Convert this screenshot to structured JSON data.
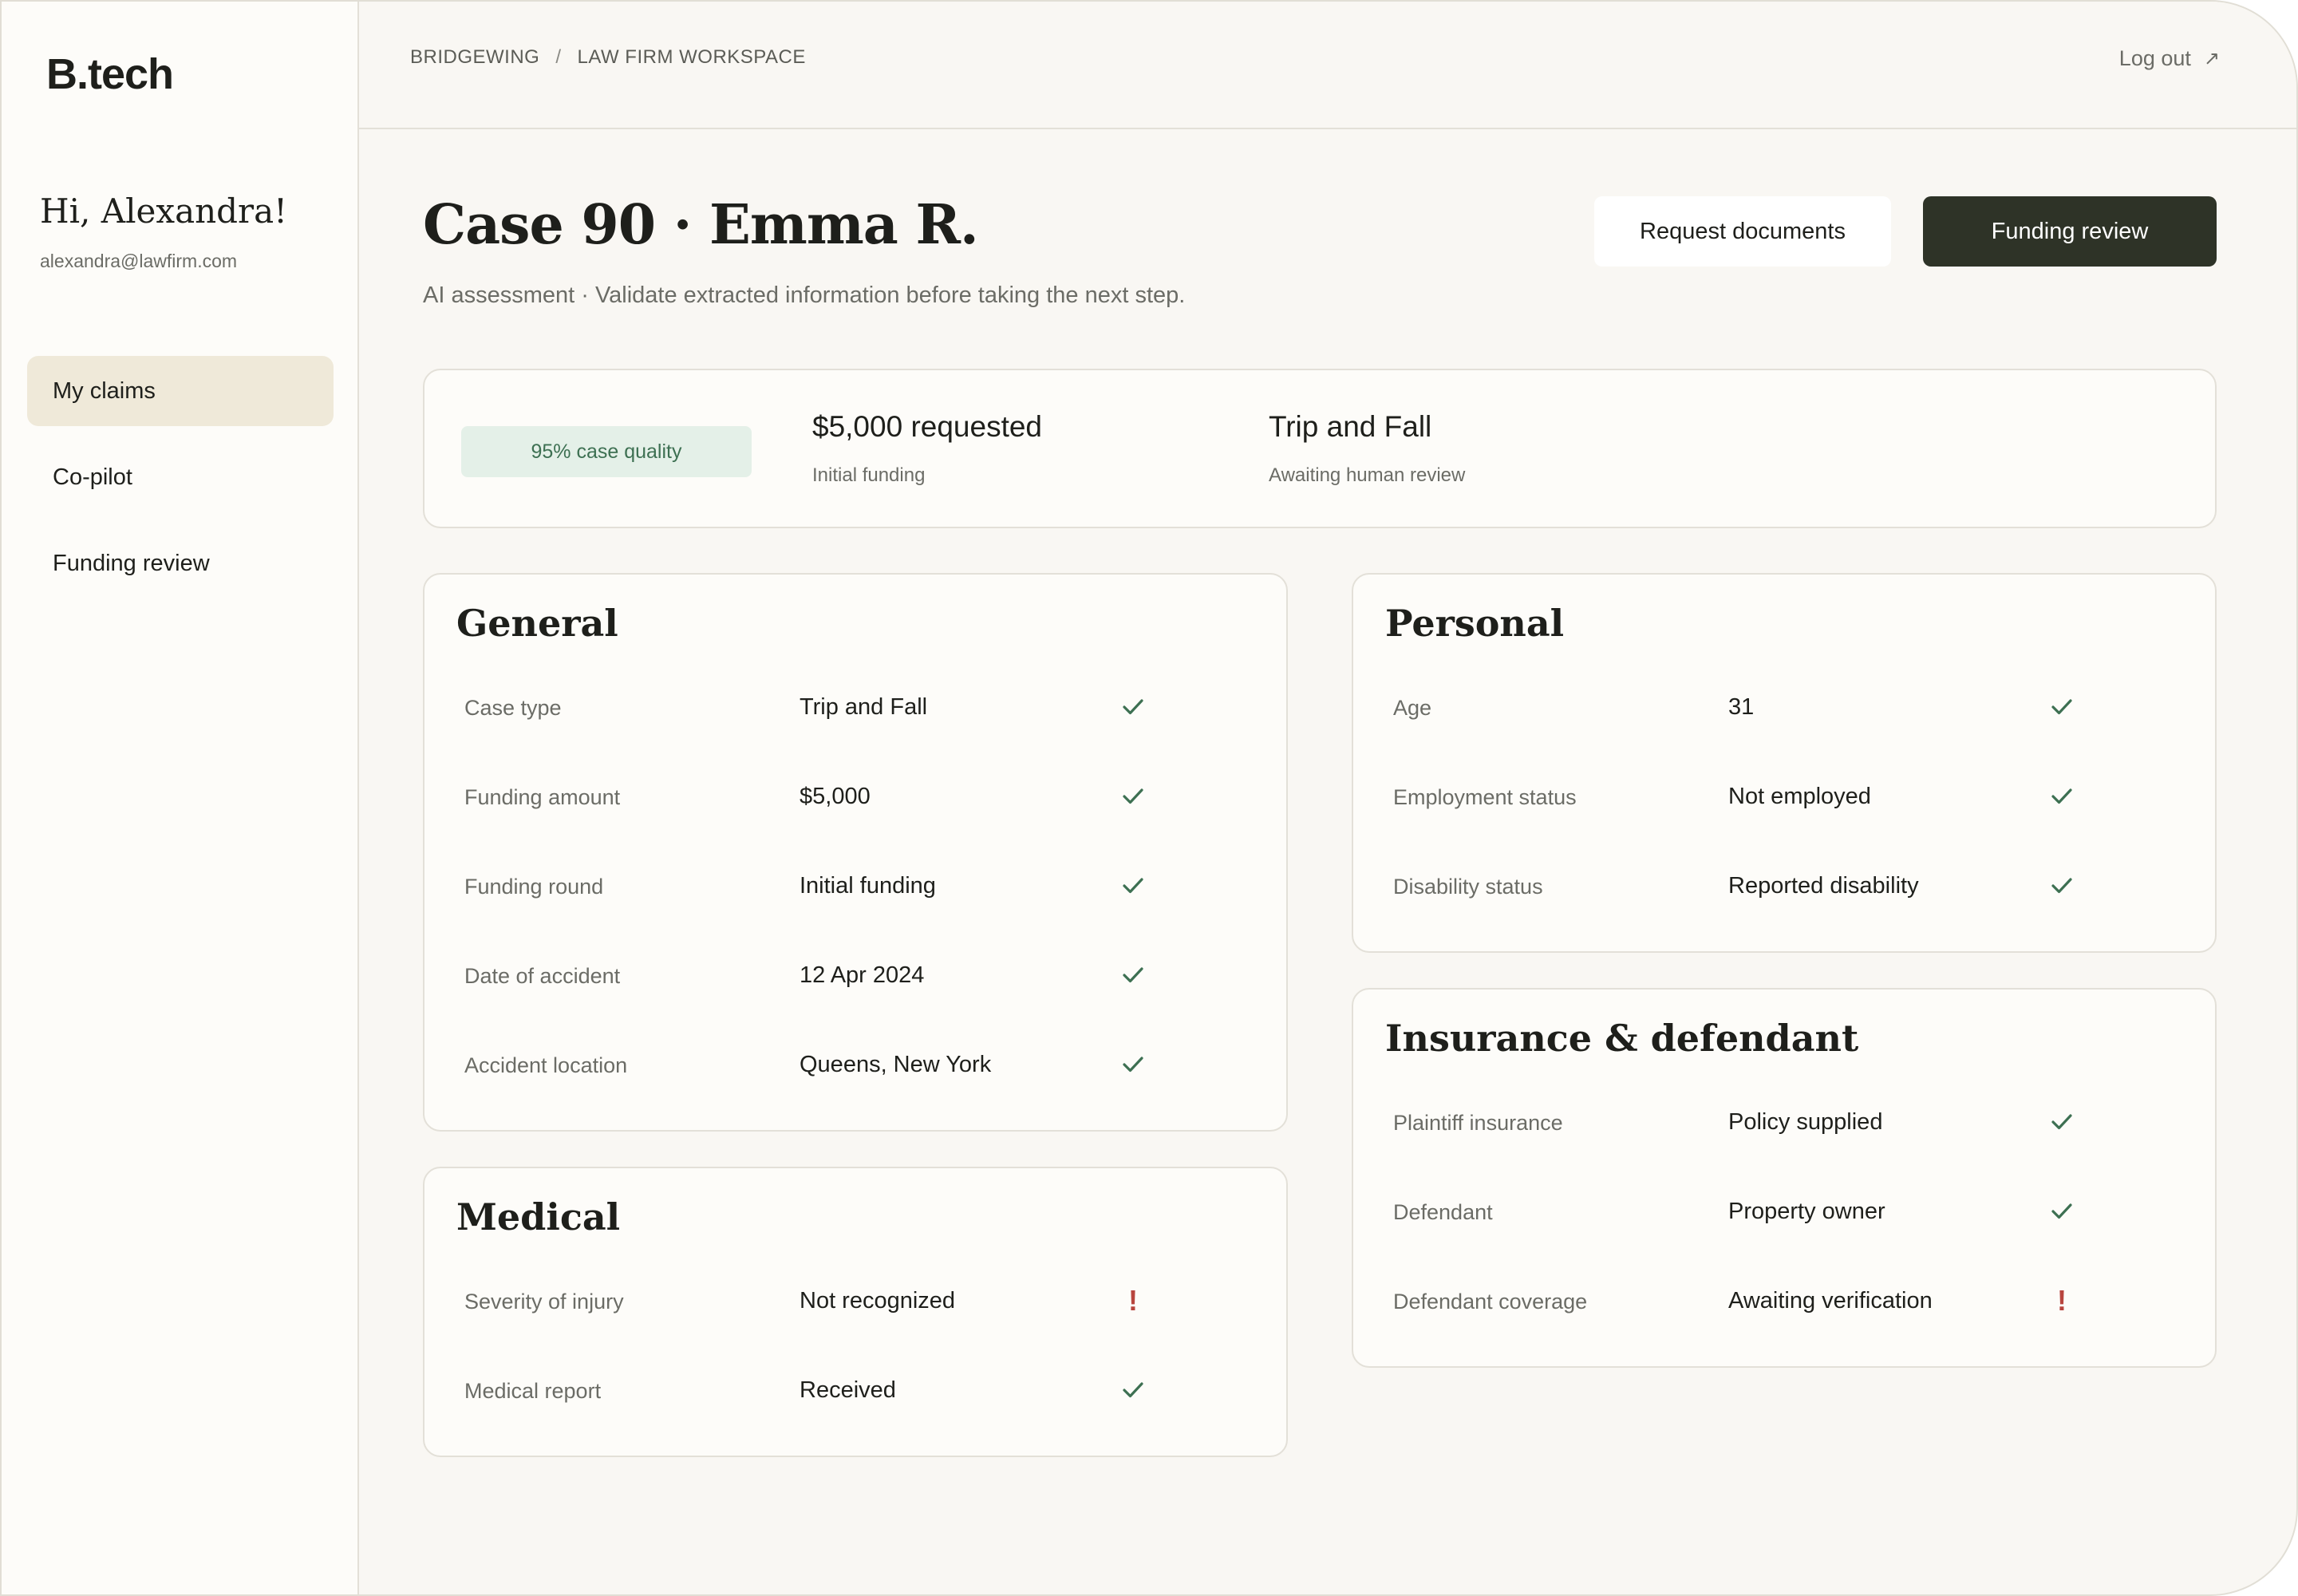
{
  "sidebar": {
    "logo": "B.tech",
    "greeting": "Hi, Alexandra!",
    "email": "alexandra@lawfirm.com",
    "nav": [
      {
        "label": "My claims",
        "active": true
      },
      {
        "label": "Co-pilot",
        "active": false
      },
      {
        "label": "Funding review",
        "active": false
      }
    ]
  },
  "topbar": {
    "breadcrumb": [
      "BRIDGEWING",
      "LAW FIRM WORKSPACE"
    ],
    "breadcrumb_separator": "/",
    "logout_label": "Log out",
    "logout_icon": "↗"
  },
  "header": {
    "title": "Case 90 · Emma R.",
    "subtitle": "AI assessment · Validate extracted information before taking the next step.",
    "request_documents_label": "Request documents",
    "funding_review_label": "Funding review"
  },
  "summary": {
    "quality_badge": "95% case quality",
    "amount": "$5,000 requested",
    "amount_sub": "Initial funding",
    "case_type": "Trip and Fall",
    "case_type_sub": "Awaiting human review"
  },
  "sections": {
    "general": {
      "title": "General",
      "rows": [
        {
          "label": "Case type",
          "value": "Trip and Fall",
          "status": "ok"
        },
        {
          "label": "Funding amount",
          "value": "$5,000",
          "status": "ok"
        },
        {
          "label": "Funding round",
          "value": "Initial funding",
          "status": "ok"
        },
        {
          "label": "Date of accident",
          "value": "12 Apr 2024",
          "status": "ok"
        },
        {
          "label": "Accident location",
          "value": "Queens, New York",
          "status": "ok"
        }
      ]
    },
    "medical": {
      "title": "Medical",
      "rows": [
        {
          "label": "Severity of injury",
          "value": "Not recognized",
          "status": "warn"
        },
        {
          "label": "Medical report",
          "value": "Received",
          "status": "ok"
        }
      ]
    },
    "personal": {
      "title": "Personal",
      "rows": [
        {
          "label": "Age",
          "value": "31",
          "status": "ok"
        },
        {
          "label": "Employment status",
          "value": "Not employed",
          "status": "ok"
        },
        {
          "label": "Disability status",
          "value": "Reported disability",
          "status": "ok"
        }
      ]
    },
    "insurance": {
      "title": "Insurance & defendant",
      "rows": [
        {
          "label": "Plaintiff insurance",
          "value": "Policy supplied",
          "status": "ok"
        },
        {
          "label": "Defendant",
          "value": "Property owner",
          "status": "ok"
        },
        {
          "label": "Defendant coverage",
          "value": "Awaiting verification",
          "status": "warn"
        }
      ]
    }
  },
  "colors": {
    "accent_dark": "#2e3327",
    "ok": "#3d7052",
    "warn": "#b8453e",
    "nav_active": "#efe9d9",
    "badge_bg": "#e4f0e8"
  },
  "icons": {
    "ok": "check-icon",
    "warn": "exclamation-icon"
  }
}
